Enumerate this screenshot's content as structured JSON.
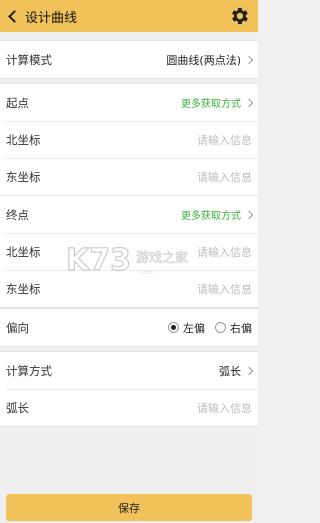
{
  "header": {
    "title": "设计曲线",
    "back_icon": "chevron-left-icon",
    "settings_icon": "gear-icon"
  },
  "calc_mode": {
    "label": "计算模式",
    "value": "圆曲线(两点法)"
  },
  "start_point": {
    "label": "起点",
    "more_link": "更多获取方式",
    "north_label": "北坐标",
    "north_placeholder": "请输入信息",
    "east_label": "东坐标",
    "east_placeholder": "请输入信息"
  },
  "end_point": {
    "label": "终点",
    "more_link": "更多获取方式",
    "north_label": "北坐标",
    "north_placeholder": "请输入信息",
    "east_label": "东坐标",
    "east_placeholder": "请输入信息"
  },
  "offset": {
    "label": "偏向",
    "options": [
      "左偏",
      "右偏"
    ],
    "selected": "左偏"
  },
  "calc_method": {
    "label": "计算方式",
    "value": "弧长",
    "arc_label": "弧长",
    "arc_placeholder": "请输入信息"
  },
  "footer": {
    "save_label": "保存"
  },
  "colors": {
    "accent": "#f2c25a",
    "link": "#3bb13b",
    "placeholder": "#bdbdbd"
  },
  "watermark": {
    "text": "K73 游戏之家"
  }
}
